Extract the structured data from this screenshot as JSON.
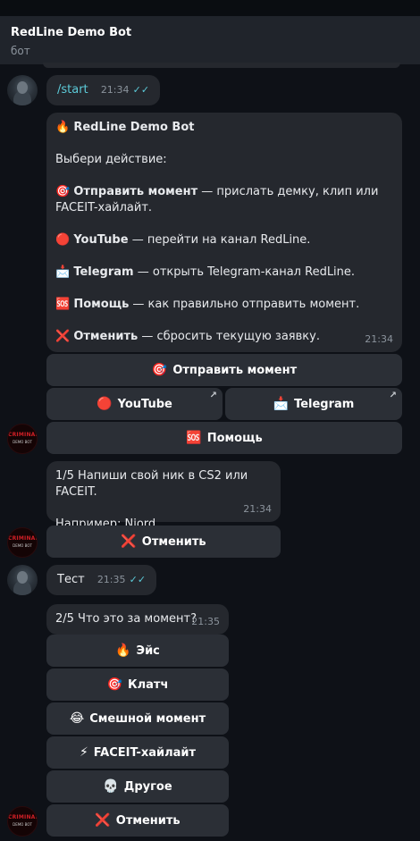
{
  "header": {
    "title": "RedLine Demo Bot",
    "subtitle": "бот"
  },
  "msg_start": {
    "text": "/start",
    "time": "21:34",
    "checks": "✓✓"
  },
  "menu": {
    "title_emoji": "🔥",
    "title": "RedLine Demo Bot",
    "prompt": "Выбери действие:",
    "items": [
      {
        "emoji": "🎯",
        "bold": "Отправить момент",
        "text": " — прислать демку, клип или FACEIT-хайлайт."
      },
      {
        "emoji": "🔴",
        "bold": "YouTube",
        "text": " — перейти на канал RedLine."
      },
      {
        "emoji": "📩",
        "bold": "Telegram",
        "text": " — открыть Telegram-канал RedLine."
      },
      {
        "emoji": "🆘",
        "bold": "Помощь",
        "text": " — как правильно отправить момент."
      },
      {
        "emoji": "❌",
        "bold": "Отменить",
        "text": " — сбросить текущую заявку."
      }
    ],
    "time": "21:34"
  },
  "menu_buttons": {
    "send": {
      "emoji": "🎯",
      "label": "Отправить момент"
    },
    "youtube": {
      "emoji": "🔴",
      "label": "YouTube",
      "arrow": "↗"
    },
    "telegram": {
      "emoji": "📩",
      "label": "Telegram",
      "arrow": "↗"
    },
    "help": {
      "emoji": "🆘",
      "label": "Помощь"
    }
  },
  "step1": {
    "line1": "1/5 Напиши свой ник в CS2 или FACEIT.",
    "line2": "Например: Njord",
    "time": "21:34"
  },
  "cancel1": {
    "emoji": "❌",
    "label": "Отменить"
  },
  "msg_test": {
    "text": "Тест",
    "time": "21:35",
    "checks": "✓✓"
  },
  "step2": {
    "text": "2/5 Что это за момент?",
    "time": "21:35"
  },
  "moment_buttons": [
    {
      "emoji": "🔥",
      "label": "Эйс"
    },
    {
      "emoji": "🎯",
      "label": "Клатч"
    },
    {
      "emoji": "😂",
      "label": "Смешной момент"
    },
    {
      "emoji": "⚡",
      "label": "FACEIT-хайлайт"
    },
    {
      "emoji": "💀",
      "label": "Другое"
    }
  ],
  "cancel2": {
    "emoji": "❌",
    "label": "Отменить"
  },
  "bot_avatar_text": {
    "line1": "CRIMINALNIE",
    "line2": "DEMO BOT"
  }
}
